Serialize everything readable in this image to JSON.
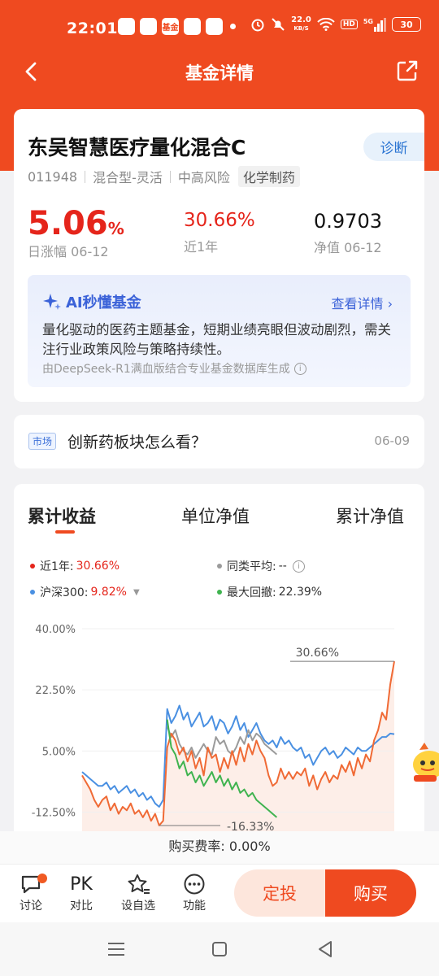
{
  "status_bar": {
    "time": "22:01",
    "apps": [
      "",
      "",
      "基金",
      "",
      ""
    ],
    "net_speed_value": "22.0",
    "net_speed_unit": "KB/S",
    "hd": "HD",
    "signal": "5G",
    "battery": "30"
  },
  "nav": {
    "title": "基金详情"
  },
  "fund": {
    "name": "东吴智慧医疗量化混合C",
    "diagnose_label": "诊断",
    "code": "011948",
    "type": "混合型-灵活",
    "risk": "中高风险",
    "sector": "化学制药",
    "daily_value": "5.06",
    "daily_unit": "%",
    "daily_label": "日涨幅 06-12",
    "year_value": "30.66%",
    "year_label": "近1年",
    "nav_value": "0.9703",
    "nav_label": "净值 06-12"
  },
  "ai": {
    "title": "AI秒懂基金",
    "link": "查看详情",
    "text": "量化驱动的医药主题基金，短期业绩亮眼但波动剧烈，需关注行业政策风险与策略持续性。",
    "footer": "由DeepSeek-R1满血版结合专业基金数据库生成"
  },
  "news": {
    "tag": "市场",
    "title": "创新药板块怎么看？",
    "date": "06-09"
  },
  "chart_tabs": [
    "累计收益",
    "单位净值",
    "累计净值"
  ],
  "legend": {
    "fund_label": "近1年:",
    "fund_value": "30.66%",
    "peer_label": "同类平均:",
    "peer_value": "--",
    "index_label": "沪深300:",
    "index_value": "9.82%",
    "drawdown_label": "最大回撤:",
    "drawdown_value": "22.39%"
  },
  "colors": {
    "accent": "#ef4a20",
    "fund": "#f06a35",
    "index": "#4a90e2",
    "peer": "#9b9b9b",
    "drawdown": "#3fb34f"
  },
  "chart_data": {
    "type": "line",
    "y_ticks": [
      "40.00%",
      "22.50%",
      "5.00%",
      "-12.50%"
    ],
    "ylim": [
      -21,
      40
    ],
    "annotations": [
      {
        "label": "30.66%",
        "value": 30.66
      },
      {
        "label": "-16.33%",
        "value": -16.33
      }
    ],
    "series": [
      {
        "name": "近1年",
        "values": [
          -2,
          -4,
          -6,
          -9,
          -11,
          -9,
          -8,
          -12,
          -10,
          -13,
          -11,
          -12,
          -10,
          -13,
          -12,
          -14,
          -12,
          -15,
          -13,
          -16.33,
          -15,
          6,
          10,
          8,
          4,
          6,
          2,
          5,
          0,
          3,
          -2,
          6,
          3,
          4,
          -1,
          3,
          0,
          5,
          1,
          6,
          2,
          7,
          4,
          8,
          5,
          3,
          -2,
          -5,
          -4,
          0,
          -3,
          -1,
          -3,
          -1,
          -2,
          0,
          -5,
          -2,
          -6,
          -3,
          -1,
          -4,
          -2,
          -3,
          1,
          -1,
          2,
          -2,
          3,
          0,
          4,
          2,
          8,
          11,
          16,
          14,
          24,
          30.66
        ]
      },
      {
        "name": "沪深300",
        "values": [
          -1,
          -2,
          -3,
          -4,
          -5,
          -5,
          -4,
          -6,
          -5,
          -7,
          -6,
          -5,
          -7,
          -6,
          -8,
          -7,
          -9,
          -8,
          -10,
          -11,
          -9,
          17,
          13,
          15,
          18,
          14,
          16,
          12,
          14,
          16,
          12,
          13,
          15,
          11,
          14,
          13,
          10,
          12,
          15,
          11,
          13,
          9,
          11,
          13,
          10,
          8,
          7,
          8,
          6,
          9,
          7,
          8,
          6,
          5,
          6,
          3,
          4,
          1,
          3,
          5,
          6,
          4,
          5,
          3,
          4,
          6,
          5,
          4,
          6,
          5,
          5,
          6,
          7,
          8,
          9,
          9,
          10,
          9.82
        ]
      },
      {
        "name": "同类平均",
        "values": [
          null,
          null,
          null,
          null,
          null,
          null,
          null,
          null,
          null,
          null,
          null,
          null,
          null,
          null,
          null,
          null,
          null,
          null,
          null,
          null,
          null,
          12,
          9,
          11,
          7,
          5,
          4,
          6,
          3,
          5,
          7,
          5,
          4,
          9,
          7,
          8,
          5,
          4,
          6,
          9,
          7,
          11,
          8,
          10,
          9,
          7,
          6,
          5,
          4,
          null,
          null,
          null,
          null,
          null,
          null,
          null,
          null,
          null,
          null,
          null,
          null,
          null,
          null,
          null,
          null,
          null,
          null,
          null,
          null,
          null,
          null,
          null,
          null,
          null,
          null,
          null,
          null,
          null
        ]
      },
      {
        "name": "最大回撤",
        "values": [
          null,
          null,
          null,
          null,
          null,
          null,
          null,
          null,
          null,
          null,
          null,
          null,
          null,
          null,
          null,
          null,
          null,
          null,
          null,
          null,
          null,
          14,
          6,
          4,
          0,
          2,
          -2,
          -1,
          -4,
          -2,
          -5,
          -3,
          -1,
          -4,
          -2,
          -5,
          -3,
          -6,
          -4,
          -7,
          -6,
          -8,
          -7,
          -9,
          -10,
          -11,
          -12,
          -13,
          -14,
          null,
          null,
          null,
          null,
          null,
          null,
          null,
          null,
          null,
          null,
          null,
          null,
          null,
          null,
          null,
          null,
          null,
          null,
          null,
          null,
          null,
          null,
          null,
          null,
          null,
          null,
          null,
          null,
          null
        ]
      }
    ]
  },
  "fee": "购买费率: 0.00%",
  "bottom_bar": {
    "discuss": "讨论",
    "pk_glyph": "PK",
    "compare": "对比",
    "watch": "设自选",
    "more": "功能",
    "sip": "定投",
    "buy": "购买"
  }
}
